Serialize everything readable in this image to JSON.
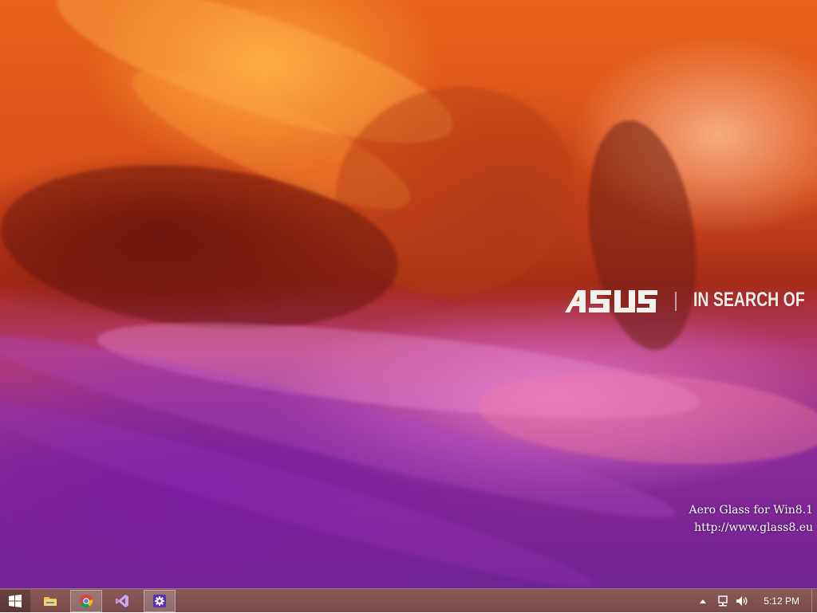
{
  "desktop": {
    "wallpaper": {
      "brand_logo": "ASUS",
      "slogan": "IN SEARCH OF",
      "colors": {
        "orange": "#e8621c",
        "red": "#a52b18",
        "purple": "#7a2a9a"
      }
    },
    "watermark": {
      "line1": "Aero Glass for Win8.1",
      "line2": "http://www.glass8.eu"
    }
  },
  "taskbar": {
    "color": "#7e4f50",
    "start_icon": "windows-logo-icon",
    "pinned": [
      {
        "name": "File Explorer",
        "icon": "folder-icon",
        "active": false
      },
      {
        "name": "Google Chrome",
        "icon": "chrome-icon",
        "active": true
      },
      {
        "name": "Visual Studio",
        "icon": "visual-studio-icon",
        "active": false
      },
      {
        "name": "Settings",
        "icon": "gear-icon",
        "active": true
      }
    ],
    "tray": {
      "icons": [
        "chevron-up-icon",
        "network-icon",
        "volume-icon"
      ],
      "clock": "5:12 PM"
    }
  }
}
